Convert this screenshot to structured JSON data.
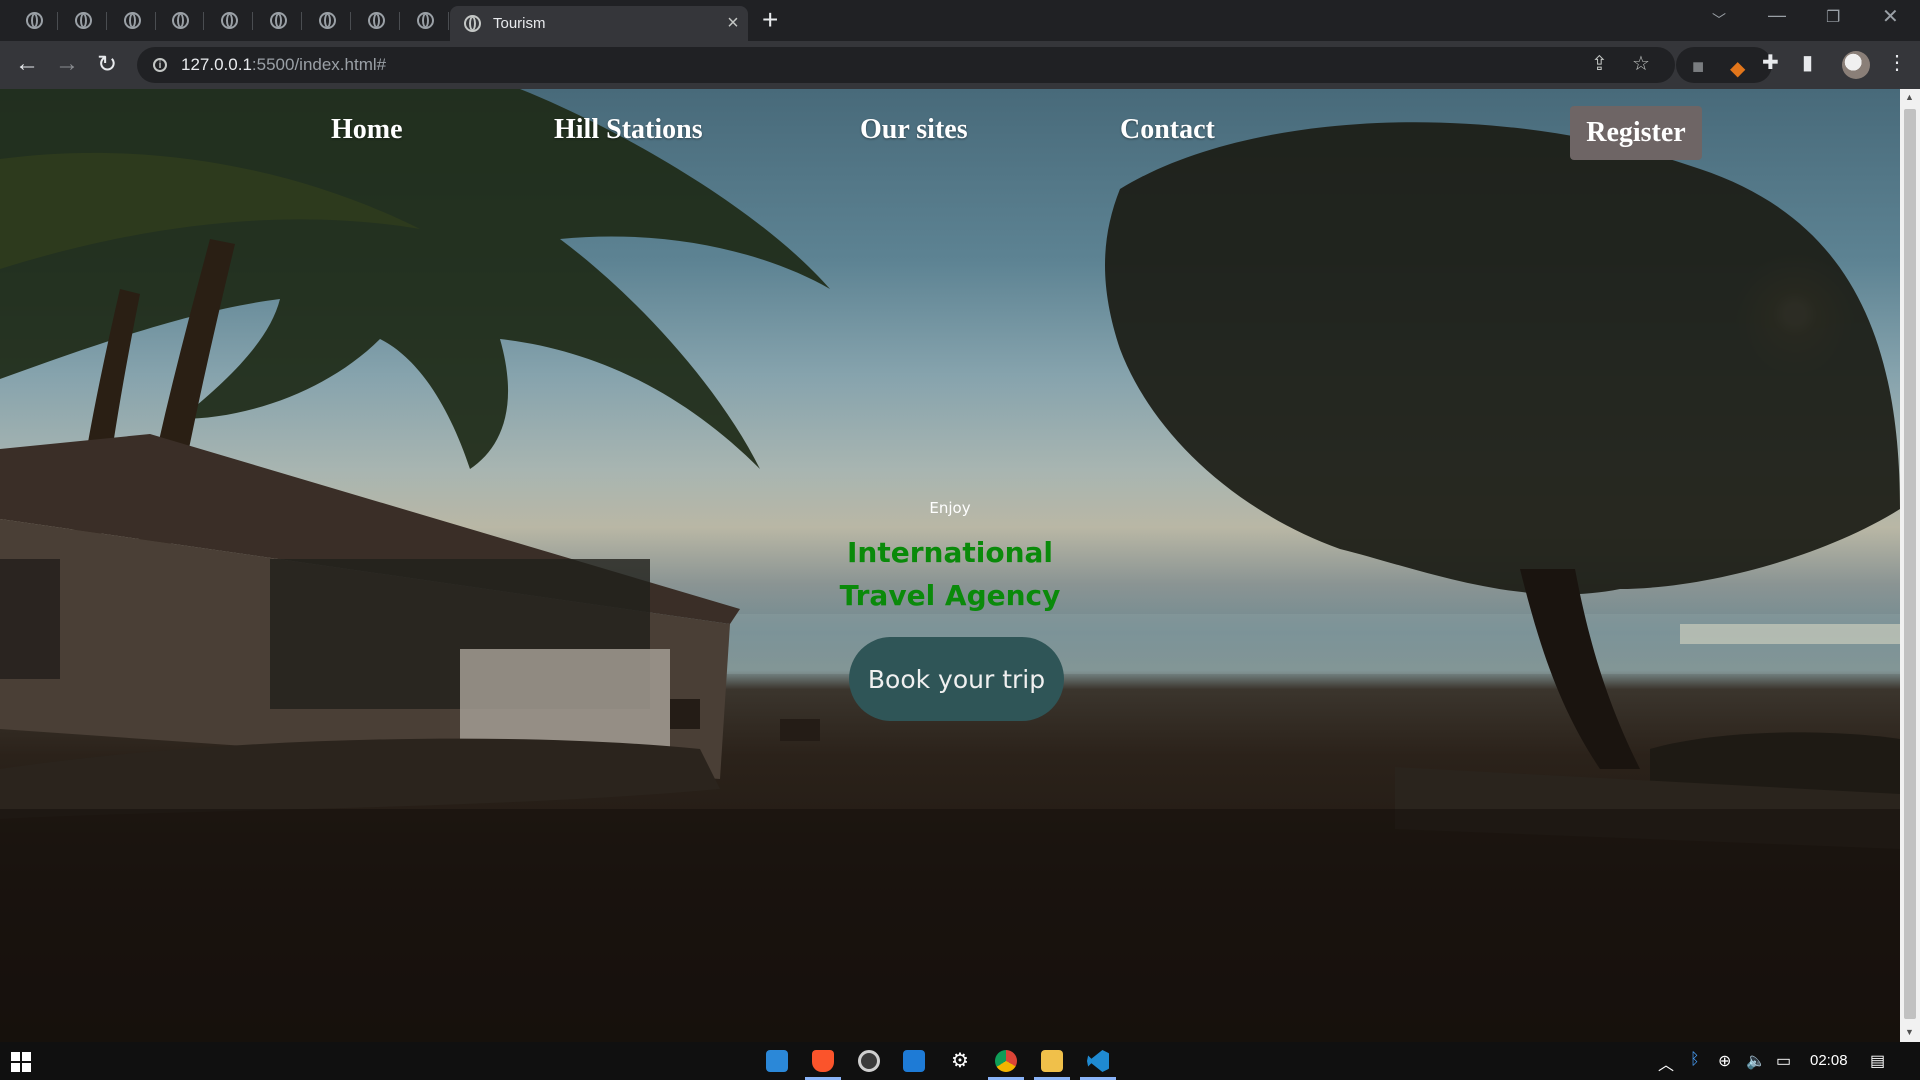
{
  "browser": {
    "active_tab_title": "Tourism",
    "pinned_tab_count": 9,
    "url_host": "127.0.0.1",
    "url_rest": ":5500/index.html#"
  },
  "site": {
    "nav": {
      "home": "Home",
      "hill_stations": "Hill Stations",
      "our_sites": "Our sites",
      "contact": "Contact",
      "register": "Register"
    },
    "hero": {
      "enjoy": "Enjoy",
      "title": "International Travel Agency",
      "cta": "Book your trip"
    }
  },
  "taskbar": {
    "time": "02:08"
  },
  "colors": {
    "hero_title": "#0a8a0a",
    "cta_background": "#2f5557",
    "register_background": "#6e6565"
  }
}
